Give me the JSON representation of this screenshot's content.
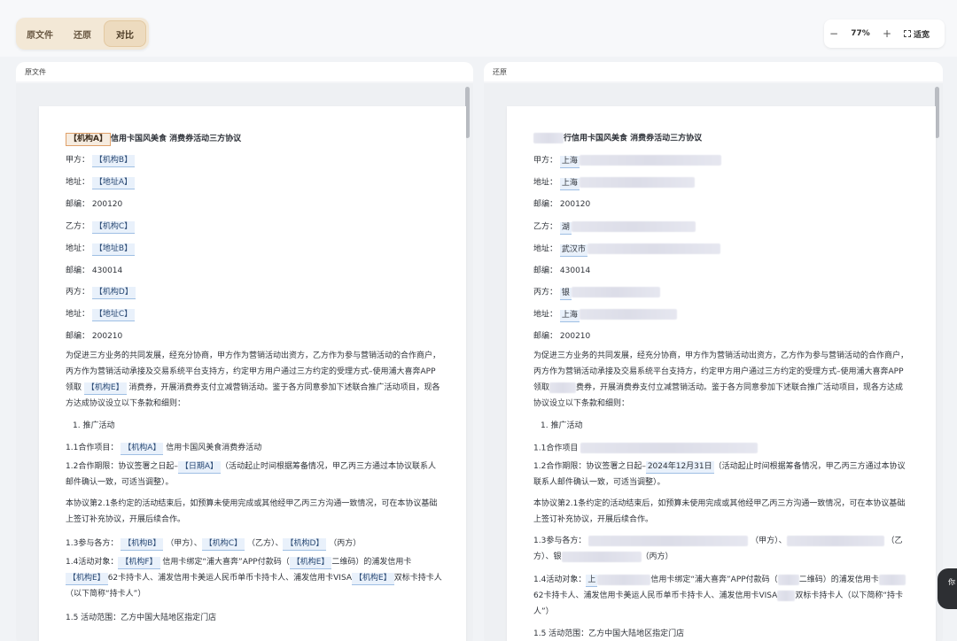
{
  "toolbar": {
    "tabs": [
      "原文件",
      "还原",
      "对比"
    ],
    "active_tab": "对比",
    "zoom_minus": "−",
    "zoom_value": "77%",
    "zoom_plus": "+",
    "fit_label": "适宽"
  },
  "left_panel": {
    "title": "原文件",
    "doc": {
      "title_tag": "【机构A】",
      "title_rest": "信用卡国风美食 消费券活动三方协议",
      "party_a_label": "甲方：",
      "party_a_value": "【机构B】",
      "addr1_label": "地址：",
      "addr1_value": "【地址A】",
      "zip1_label": "邮编：",
      "zip1_value": "200120",
      "party_b_label": "乙方：",
      "party_b_value": "【机构C】",
      "addr2_label": "地址：",
      "addr2_value": "【地址B】",
      "zip2_label": "邮编：",
      "zip2_value": "430014",
      "party_c_label": "丙方：",
      "party_c_value": "【机构D】",
      "addr3_label": "地址：",
      "addr3_value": "【地址C】",
      "zip3_label": "邮编：",
      "zip3_value": "200210",
      "intro_1": "为促进三方业务的共同发展，经充分协商，甲方作为营销活动出资方，乙方作为参与营销活动的合作商户，丙方作为营销活动承接及交易系统平台支持方，约定甲方用户通过三方约定的受理方式–使用浦大喜奔APP领取",
      "intro_tag": "【机构E】",
      "intro_2": "消费券，开展消费券支付立减营销活动。鉴于各方同意参加下述联合推广活动项目，现各方达成协议设立以下条款和细则：",
      "sec1": "1. 推广活动",
      "item11_label": "1.1合作项目：",
      "item11_tag": "【机构A】",
      "item11_rest": "信用卡国风美食消费券活动",
      "item12_a": "1.2合作期限：协议签署之日起–",
      "item12_tag": "【日期A】",
      "item12_b": "（活动起止时间根据筹备情况，甲乙丙三方通过本协议联系人邮件确认一致，可适当调整）。",
      "para_adjust": "本协议第2.1条约定的活动结束后，如预算未使用完成或其他经甲乙丙三方沟通一致情况，可在本协议基础上签订补充协议，开展后续合作。",
      "item13_label": "1.3参与各方：",
      "item13_tag_a": "【机构B】",
      "item13_a": "（甲方）、",
      "item13_tag_b": "【机构C】",
      "item13_b": "（乙方）、",
      "item13_tag_c": "【机构D】",
      "item13_c": "（丙方）",
      "item14_a": "1.4活动对象：",
      "item14_tag_a": "【机构F】",
      "item14_b": "信用卡绑定“浦大喜奔”APP付款码（",
      "item14_tag_b": "【机构E】",
      "item14_c": "二维码）的浦发信用卡",
      "item14_tag_c": "【机构E】",
      "item14_d": "62卡持卡人、浦发信用卡美运人民币单币卡持卡人、浦发信用卡VISA",
      "item14_tag_d": "【机构E】",
      "item14_e": "双标卡持卡人（以下简称“持卡人”）",
      "item15": "1.5 活动范围：乙方中国大陆地区指定门店"
    }
  },
  "right_panel": {
    "title": "还原",
    "doc": {
      "title_rest": "行信用卡国风美食 消费券活动三方协议",
      "party_a_label": "甲方：",
      "party_a_value": "上海",
      "addr1_label": "地址：",
      "addr1_value": "上海",
      "zip1_label": "邮编：",
      "zip1_value": "200120",
      "party_b_label": "乙方：",
      "party_b_value": "湖",
      "addr2_label": "地址：",
      "addr2_value": "武汉市",
      "zip2_label": "邮编：",
      "zip2_value": "430014",
      "party_c_label": "丙方：",
      "party_c_value": "银",
      "addr3_label": "地址：",
      "addr3_value": "上海",
      "zip3_label": "邮编：",
      "zip3_value": "200210",
      "intro": "为促进三方业务的共同发展，经充分协商，甲方作为营销活动出资方，乙方作为参与营销活动的合作商户，丙方作为营销活动承接及交易系统平台支持方，约定甲方用户通过三方约定的受理方式–使用浦大喜奔APP领取",
      "intro_2": "费券，开展消费券支付立减营销活动。鉴于各方同意参加下述联合推广活动项目，现各方达成协议设立以下条款和细则：",
      "sec1": "1. 推广活动",
      "item11_label": "1.1合作项目",
      "item12_a": "1.2合作期限：协议签署之日起–",
      "item12_date": "2024年12月31日",
      "item12_b": "（活动起止时间根据筹备情况，甲乙丙三方通过本协议联系人邮件确认一致，可适当调整）。",
      "para_adjust": "本协议第2.1条约定的活动结束后，如预算未使用完成或其他经甲乙丙三方沟通一致情况，可在本协议基础上签订补充协议，开展后续合作。",
      "item13_label": "1.3参与各方：",
      "item13_a": "（甲方）、",
      "item13_b": "（乙方）、银",
      "item13_c": "（丙方）",
      "item14_a": "1.4活动对象：",
      "item14_a2": "上",
      "item14_b": "信用卡绑定“浦大喜奔”APP付款码（",
      "item14_c": "二维码）的浦发信用卡",
      "item14_d": "62卡持卡人、浦发信用卡美运人民币单币卡持卡人、浦发信用卡VISA",
      "item14_e": "双标卡持卡人（以下简称“持卡人”）",
      "item15": "1.5 活动范围：乙方中国大陆地区指定门店"
    }
  },
  "fab_label": "你"
}
